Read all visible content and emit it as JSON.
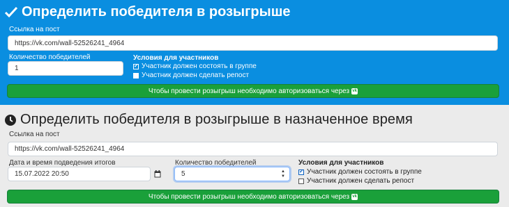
{
  "section1": {
    "title": "Определить победителя в розыгрыше",
    "post_label": "Ссылка на пост",
    "post_value": "https://vk.com/wall-52526241_4964",
    "winners_label": "Количество победителей",
    "winners_value": "1",
    "conditions_title": "Условия для участников",
    "conditions": [
      {
        "label": "Участник должен состоять в группе",
        "checked": true
      },
      {
        "label": "Участник должен сделать репост",
        "checked": false
      }
    ],
    "button_label": "Чтобы провести розыгрыш необходимо авторизоваться через",
    "button_icon": "vk-icon"
  },
  "section2": {
    "title": "Определить победителя в розыгрыше в назначенное время",
    "post_label": "Ссылка на пост",
    "post_value": "https://vk.com/wall-52526241_4964",
    "date_label": "Дата и время подведения итогов",
    "date_value": "15.07.2022 20:50",
    "winners_label": "Количество победителей",
    "winners_value": "5",
    "conditions_title": "Условия для участников",
    "conditions": [
      {
        "label": "Участник должен состоять в группе",
        "checked": true
      },
      {
        "label": "Участник должен сделать репост",
        "checked": false
      }
    ],
    "button_label": "Чтобы провести розыгрыш необходимо авторизоваться через",
    "button_icon": "vk-icon"
  },
  "colors": {
    "panel_blue": "#0a8ee0",
    "button_green": "#1aa03a",
    "panel_gray": "#ebebeb"
  }
}
